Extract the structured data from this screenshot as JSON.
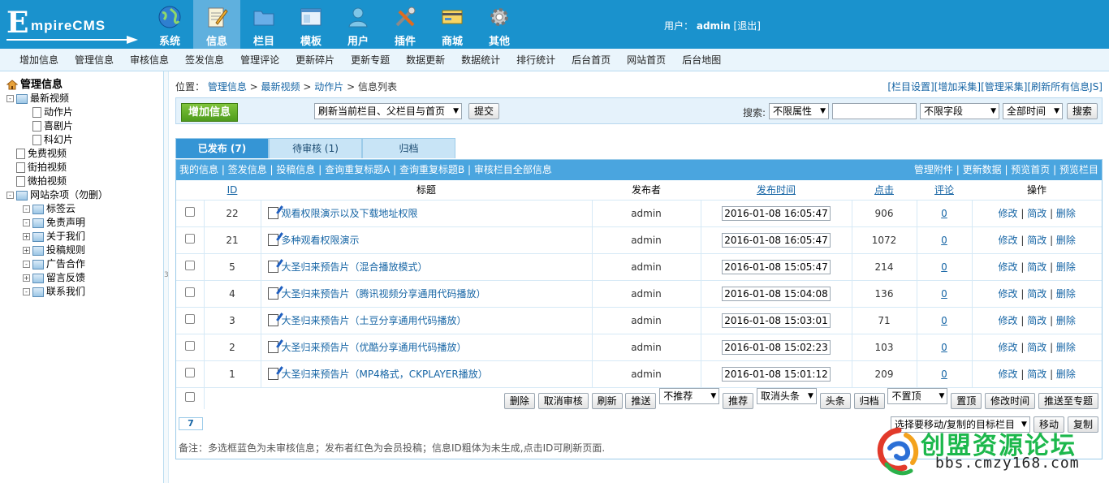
{
  "logo": {
    "letter": "E",
    "text": "mpireCMS"
  },
  "top_nav": [
    {
      "label": "系统",
      "icon": "globe-icon"
    },
    {
      "label": "信息",
      "icon": "notepad-icon",
      "active": true
    },
    {
      "label": "栏目",
      "icon": "folder-icon"
    },
    {
      "label": "模板",
      "icon": "window-icon"
    },
    {
      "label": "用户",
      "icon": "user-icon"
    },
    {
      "label": "插件",
      "icon": "tools-icon"
    },
    {
      "label": "商城",
      "icon": "card-icon"
    },
    {
      "label": "其他",
      "icon": "gear-icon"
    }
  ],
  "user": {
    "prefix": "用户：",
    "name": "admin",
    "logout": "[退出]"
  },
  "sub_nav": [
    "增加信息",
    "管理信息",
    "审核信息",
    "签发信息",
    "管理评论",
    "更新碎片",
    "更新专题",
    "数据更新",
    "数据统计",
    "排行统计",
    "后台首页",
    "网站首页",
    "后台地图"
  ],
  "tree": {
    "root": "管理信息",
    "nodes": [
      {
        "label": "最新视频",
        "level": 0,
        "type": "folder",
        "sign": "-"
      },
      {
        "label": "动作片",
        "level": 1,
        "type": "doc"
      },
      {
        "label": "喜剧片",
        "level": 1,
        "type": "doc"
      },
      {
        "label": "科幻片",
        "level": 1,
        "type": "doc"
      },
      {
        "label": "免费视频",
        "level": 0,
        "type": "doc"
      },
      {
        "label": "街拍视频",
        "level": 0,
        "type": "doc"
      },
      {
        "label": "微拍视频",
        "level": 0,
        "type": "doc"
      },
      {
        "label": "网站杂项（勿删）",
        "level": 0,
        "type": "folder",
        "sign": "-"
      },
      {
        "label": "标签云",
        "level": 1,
        "type": "folder",
        "sign": "-"
      },
      {
        "label": "免责声明",
        "level": 1,
        "type": "folder",
        "sign": "-"
      },
      {
        "label": "关于我们",
        "level": 1,
        "type": "folder",
        "sign": "+"
      },
      {
        "label": "投稿规则",
        "level": 1,
        "type": "folder",
        "sign": "+"
      },
      {
        "label": "广告合作",
        "level": 1,
        "type": "folder",
        "sign": "-"
      },
      {
        "label": "留言反馈",
        "level": 1,
        "type": "folder",
        "sign": "+"
      },
      {
        "label": "联系我们",
        "level": 1,
        "type": "folder",
        "sign": "-"
      }
    ]
  },
  "splitter_label": "3",
  "crumb": {
    "prefix": "位置：",
    "path": [
      "管理信息",
      "最新视频",
      "动作片"
    ],
    "current": "信息列表",
    "right_links": [
      "[栏目设置]",
      "[增加采集]",
      "[管理采集]",
      "[刷新所有信息JS]"
    ]
  },
  "toolbar": {
    "add": "增加信息",
    "refresh_select": "刷新当前栏目、父栏目与首页",
    "submit": "提交",
    "search_label": "搜索:",
    "attr_select": "不限属性",
    "search_value": "",
    "field_select": "不限字段",
    "time_select": "全部时间",
    "search_btn": "搜索"
  },
  "tabs": [
    "已发布 (7)",
    "待审核 (1)",
    "归档"
  ],
  "panel_links_left": [
    "我的信息",
    "签发信息",
    "投稿信息",
    "查询重复标题A",
    "查询重复标题B",
    "审核栏目全部信息"
  ],
  "panel_links_right": [
    "管理附件",
    "更新数据",
    "预览首页",
    "预览栏目"
  ],
  "headers": {
    "id": "ID",
    "title": "标题",
    "publisher": "发布者",
    "time": "发布时间",
    "clicks": "点击",
    "comments": "评论",
    "ops": "操作"
  },
  "rows": [
    {
      "id": "22",
      "title": "观看权限演示以及下载地址权限",
      "publisher": "admin",
      "time": "2016-01-08 16:05:47",
      "clicks": "906",
      "comments": "0"
    },
    {
      "id": "21",
      "title": "多种观看权限演示",
      "publisher": "admin",
      "time": "2016-01-08 16:05:47",
      "clicks": "1072",
      "comments": "0"
    },
    {
      "id": "5",
      "title": "大圣归来预告片（混合播放模式）",
      "publisher": "admin",
      "time": "2016-01-08 15:05:47",
      "clicks": "214",
      "comments": "0"
    },
    {
      "id": "4",
      "title": "大圣归来预告片（腾讯视频分享通用代码播放）",
      "publisher": "admin",
      "time": "2016-01-08 15:04:08",
      "clicks": "136",
      "comments": "0"
    },
    {
      "id": "3",
      "title": "大圣归来预告片（土豆分享通用代码播放）",
      "publisher": "admin",
      "time": "2016-01-08 15:03:01",
      "clicks": "71",
      "comments": "0"
    },
    {
      "id": "2",
      "title": "大圣归来预告片（优酷分享通用代码播放）",
      "publisher": "admin",
      "time": "2016-01-08 15:02:23",
      "clicks": "103",
      "comments": "0"
    },
    {
      "id": "1",
      "title": "大圣归来预告片（MP4格式，CKPLAYER播放）",
      "publisher": "admin",
      "time": "2016-01-08 15:01:12",
      "clicks": "209",
      "comments": "0"
    }
  ],
  "row_ops": [
    "修改",
    "简改",
    "删除"
  ],
  "bulk": {
    "delete": "删除",
    "unaudit": "取消审核",
    "refresh": "刷新",
    "push": "推送",
    "recommend_select": "不推荐",
    "recommend": "推荐",
    "headline_select": "取消头条",
    "headline": "头条",
    "archive": "归档",
    "top_select": "不置顶",
    "top": "置顶",
    "change_time": "修改时间",
    "push_topic": "推送至专题"
  },
  "page_num": "7",
  "move": {
    "select": "选择要移动/复制的目标栏目",
    "move": "移动",
    "copy": "复制"
  },
  "note": "备注：多选框蓝色为未审核信息；发布者红色为会员投稿；信息ID粗体为未生成,点击ID可刷新页面.",
  "watermark": {
    "text": "创盟资源论坛",
    "url": "bbs.cmzy168.com"
  },
  "colors": {
    "header_bg": "#1a92cd",
    "active_tab": "#3595d5",
    "add_btn": "#5fa824",
    "link": "#1665a5"
  }
}
